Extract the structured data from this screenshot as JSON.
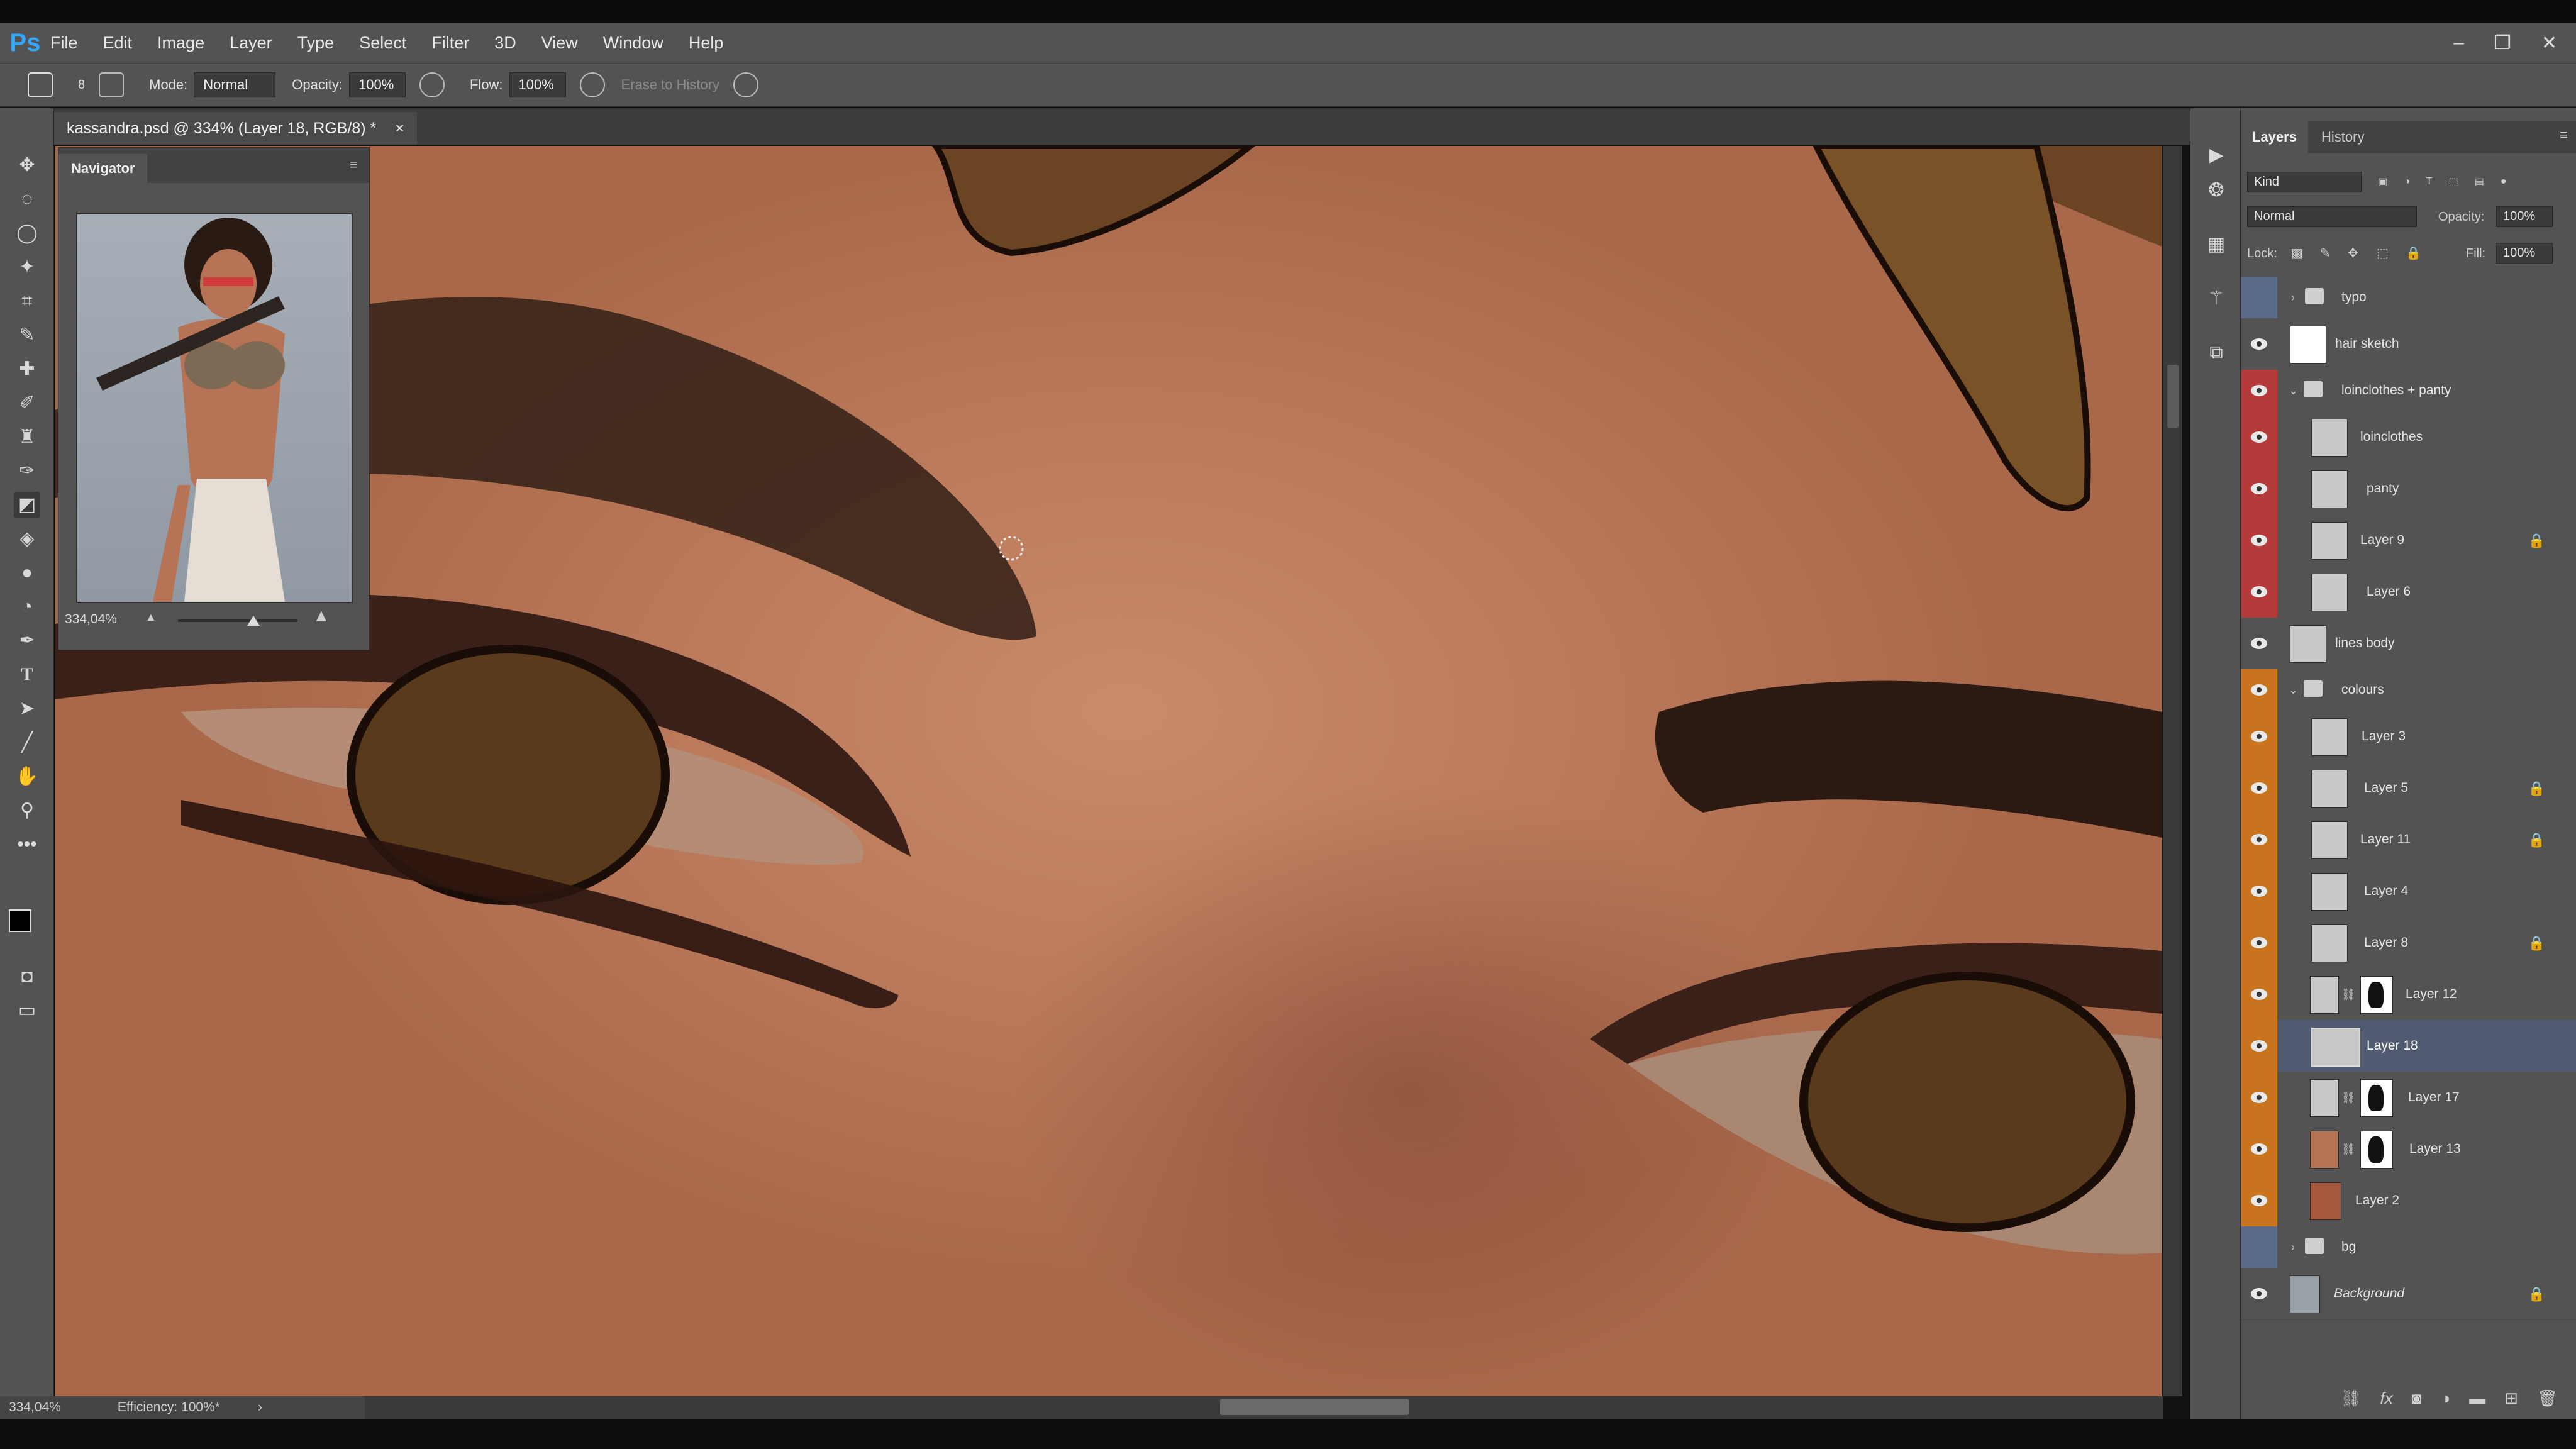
{
  "app": {
    "logo": "Ps"
  },
  "menu": [
    "File",
    "Edit",
    "Image",
    "Layer",
    "Type",
    "Select",
    "Filter",
    "3D",
    "View",
    "Window",
    "Help"
  ],
  "window_controls": {
    "minimize": "–",
    "restore": "❐",
    "close": "✕"
  },
  "options": {
    "brush_size": "8",
    "mode_label": "Mode:",
    "mode_value": "Normal",
    "opacity_label": "Opacity:",
    "opacity_value": "100%",
    "flow_label": "Flow:",
    "flow_value": "100%",
    "erase_history": "Erase to History"
  },
  "document": {
    "tab_title": "kassandra.psd @ 334% (Layer 18, RGB/8) *",
    "close": "×"
  },
  "navigator": {
    "title": "Navigator",
    "zoom": "334,04%"
  },
  "status": {
    "zoom": "334,04%",
    "efficiency": "Efficiency: 100%*"
  },
  "layers_panel": {
    "tabs": [
      "Layers",
      "History"
    ],
    "filter": "Kind",
    "blend_mode": "Normal",
    "opacity_label": "Opacity:",
    "opacity_value": "100%",
    "lock_label": "Lock:",
    "fill_label": "Fill:",
    "fill_value": "100%",
    "layers": [
      {
        "name": "typo",
        "type": "group",
        "visible": false,
        "color": "blue",
        "expanded": false
      },
      {
        "name": "hair sketch",
        "type": "layer",
        "visible": true,
        "color": "none"
      },
      {
        "name": "loinclothes + panty",
        "type": "group",
        "visible": true,
        "color": "red",
        "expanded": true
      },
      {
        "name": "loinclothes",
        "type": "layer",
        "visible": true,
        "color": "red",
        "indent": true
      },
      {
        "name": "panty",
        "type": "layer",
        "visible": true,
        "color": "red",
        "indent": true
      },
      {
        "name": "Layer 9",
        "type": "layer",
        "visible": true,
        "color": "red",
        "indent": true,
        "locked": true
      },
      {
        "name": "Layer 6",
        "type": "layer",
        "visible": true,
        "color": "red",
        "indent": true
      },
      {
        "name": "lines body",
        "type": "layer",
        "visible": true,
        "color": "none"
      },
      {
        "name": "colours",
        "type": "group",
        "visible": true,
        "color": "orange",
        "expanded": true
      },
      {
        "name": "Layer 3",
        "type": "layer",
        "visible": true,
        "color": "orange",
        "indent": true
      },
      {
        "name": "Layer 5",
        "type": "layer",
        "visible": true,
        "color": "orange",
        "indent": true,
        "locked": true
      },
      {
        "name": "Layer 11",
        "type": "layer",
        "visible": true,
        "color": "orange",
        "indent": true,
        "locked": true
      },
      {
        "name": "Layer 4",
        "type": "layer",
        "visible": true,
        "color": "orange",
        "indent": true
      },
      {
        "name": "Layer 8",
        "type": "layer",
        "visible": true,
        "color": "orange",
        "indent": true,
        "locked": true
      },
      {
        "name": "Layer 12",
        "type": "layer",
        "visible": true,
        "color": "orange",
        "indent": true,
        "mask": true
      },
      {
        "name": "Layer 18",
        "type": "layer",
        "visible": true,
        "color": "orange",
        "indent": true,
        "selected": true
      },
      {
        "name": "Layer 17",
        "type": "layer",
        "visible": true,
        "color": "orange",
        "indent": true,
        "mask": true
      },
      {
        "name": "Layer 13",
        "type": "layer",
        "visible": true,
        "color": "orange",
        "indent": true,
        "mask": true
      },
      {
        "name": "Layer 2",
        "type": "layer",
        "visible": true,
        "color": "orange",
        "indent": true
      },
      {
        "name": "bg",
        "type": "group",
        "visible": false,
        "color": "blue",
        "expanded": false
      },
      {
        "name": "Background",
        "type": "layer",
        "visible": true,
        "color": "none",
        "locked": true,
        "italic": true
      }
    ]
  },
  "colors": {
    "accent": "#31a8ff",
    "selected_layer": "#505a70",
    "red_label": "#b53b3b",
    "orange_label": "#c9731f",
    "blue_label": "#5a6a8a"
  }
}
